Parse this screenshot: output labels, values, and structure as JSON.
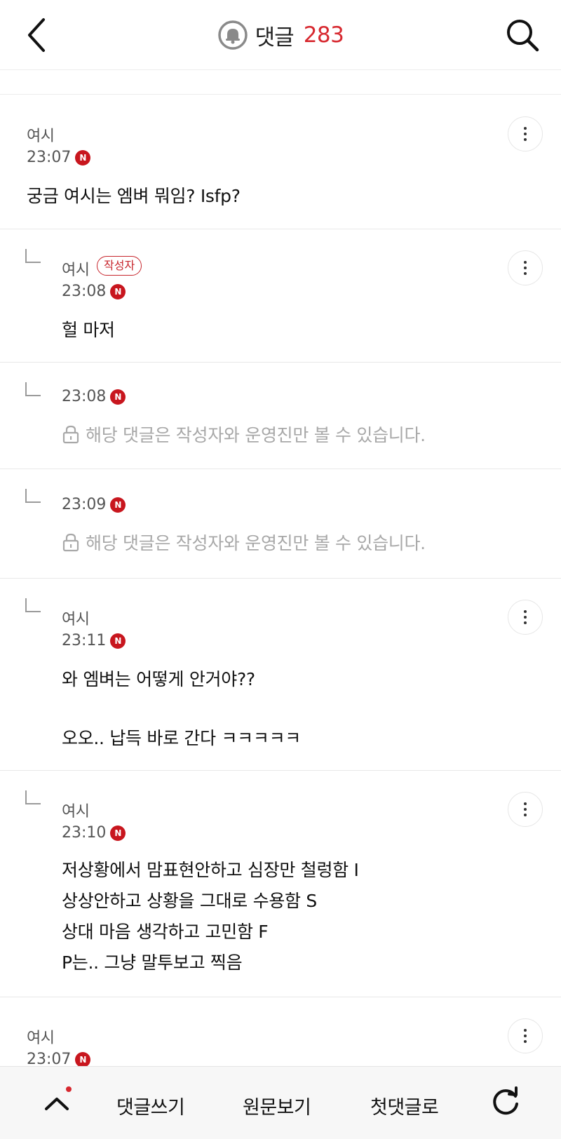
{
  "header": {
    "title": "댓글",
    "count": "283",
    "back_icon": "chevron-left-icon",
    "bell_icon": "bell-icon",
    "search_icon": "search-icon"
  },
  "comments": [
    {
      "author": "여시",
      "time": "23:07",
      "new": "N",
      "text": "궁금 여시는 엠벼 뭐임? Isfp?"
    },
    {
      "author": "여시",
      "badge": "작성자",
      "time": "23:08",
      "new": "N",
      "text": "헐 마저"
    },
    {
      "time": "23:08",
      "new": "N",
      "private": "해당 댓글은 작성자와 운영진만 볼 수 있습니다."
    },
    {
      "time": "23:09",
      "new": "N",
      "private": "해당 댓글은 작성자와 운영진만 볼 수 있습니다."
    },
    {
      "author": "여시",
      "time": "23:11",
      "new": "N",
      "lines": [
        "와 엠벼는 어떻게 안거야??",
        "",
        "오오.. 납득 바로 간다 ㅋㅋㅋㅋㅋ"
      ]
    },
    {
      "author": "여시",
      "time": "23:10",
      "new": "N",
      "lines": [
        "저상황에서 맘표현안하고 심장만 철렁함 I",
        "상상안하고 상황을 그대로 수용함 S",
        "상대 마음 생각하고 고민함 F",
        "P는.. 그냥 말투보고 찍음"
      ]
    },
    {
      "author": "여시",
      "time": "23:07",
      "new": "N"
    }
  ],
  "bottom_bar": {
    "write": "댓글쓰기",
    "original": "원문보기",
    "first": "첫댓글로",
    "up_icon": "chevron-up-icon",
    "refresh_icon": "refresh-icon"
  },
  "colors": {
    "accent": "#d7282f",
    "new_badge": "#c8161e",
    "muted": "#a8a8a8"
  }
}
